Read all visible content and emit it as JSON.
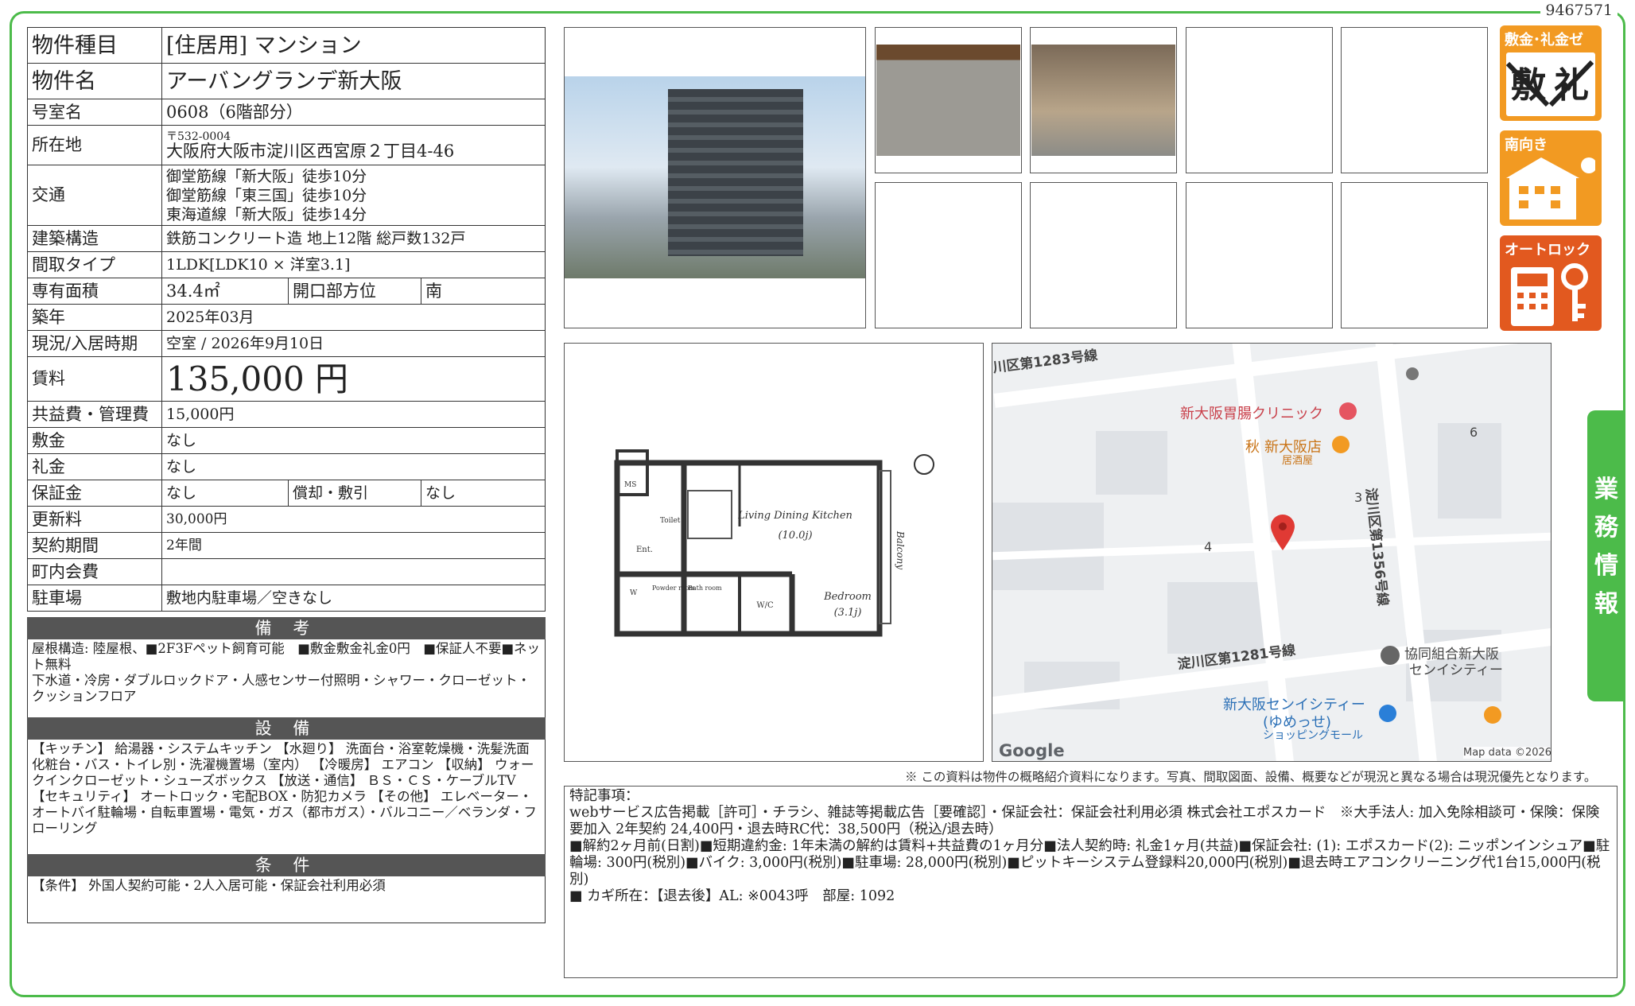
{
  "doc_id": "9467571",
  "rows": [
    {
      "label": "物件種目",
      "value": "[住居用]  マンション"
    },
    {
      "label": "物件名",
      "value": "アーバングランデ新大阪"
    },
    {
      "label": "号室名",
      "value": "0608（6階部分）"
    },
    {
      "label": "所在地",
      "postal": "〒532-0004",
      "value": "大阪府大阪市淀川区西宮原２丁目4-46"
    },
    {
      "label": "交通",
      "lines": [
        "御堂筋線「新大阪」徒歩10分",
        "御堂筋線「東三国」徒歩10分",
        "東海道線「新大阪」徒歩14分"
      ]
    },
    {
      "label": "建築構造",
      "value": "鉄筋コンクリート造 地上12階 総戸数132戸"
    },
    {
      "label": "間取タイプ",
      "value": "1LDK[LDK10 × 洋室3.1]"
    },
    {
      "label": "専有面積",
      "value": "34.4㎡",
      "label2": "開口部方位",
      "value2": "南"
    },
    {
      "label": "築年",
      "value": "2025年03月"
    },
    {
      "label": "現況/入居時期",
      "value": "空室 /  2026年9月10日"
    },
    {
      "label": "賃料",
      "value": "135,000 円"
    },
    {
      "label": "共益費・管理費",
      "value": "15,000円"
    },
    {
      "label": "敷金",
      "value": "なし"
    },
    {
      "label": "礼金",
      "value": "なし"
    },
    {
      "label": "保証金",
      "value": "なし",
      "label2": "償却・敷引",
      "value2": "なし"
    },
    {
      "label": "更新料",
      "value": "30,000円"
    },
    {
      "label": "契約期間",
      "value": "2年間"
    },
    {
      "label": "町内会費",
      "value": ""
    },
    {
      "label": "駐車場",
      "value": "敷地内駐車場／空きなし"
    }
  ],
  "remarks": {
    "title": "備 考",
    "text": "屋根構造: 陸屋根、■2F3Fペット飼育可能　■敷金敷金礼金0円　■保証人不要■ネット無料\n下水道・冷房・ダブルロックドア・人感センサー付照明・シャワー・クローゼット・クッションフロア"
  },
  "equipment": {
    "title": "設 備",
    "text": "【キッチン】 給湯器・システムキッチン 【水廻り】 洗面台・浴室乾燥機・洗髪洗面化粧台・バス・トイレ別・洗濯機置場（室内） 【冷暖房】 エアコン 【収納】 ウォークインクローゼット・シューズボックス 【放送・通信】 ＢＳ・ＣＳ・ケーブルTV 【セキュリティ】 オートロック・宅配BOX・防犯カメラ 【その他】 エレベーター・オートバイ駐輪場・自転車置場・電気・ガス（都市ガス）・バルコニー／ベランダ・フローリング"
  },
  "conditions": {
    "title": "条 件",
    "text": "【条件】 外国人契約可能・2人入居可能・保証会社利用必須"
  },
  "badges": [
    {
      "title": "敷金･礼金ゼロ",
      "icon": "no-deposit-icon"
    },
    {
      "title": "南向き",
      "icon": "south-facing-icon"
    },
    {
      "title": "オートロック",
      "icon": "autolock-icon"
    }
  ],
  "side_tab": "業務情報",
  "floor_plan": {
    "ldk": "Living Dining Kitchen",
    "ldk_size": "(10.0j)",
    "bedroom": "Bedroom",
    "bedroom_size": "(3.1j)",
    "balcony": "Balcony",
    "wic": "W/C",
    "ent": "Ent.",
    "toilet": "Toilet",
    "powder": "Powder room",
    "ms": "MS",
    "bath": "Bath room",
    "w": "W"
  },
  "map": {
    "road1": "川区第1283号線",
    "road2": "淀川区第1281号線",
    "road3": "淀川区第1356号線",
    "poi1": "新大阪胃腸クリニック",
    "poi2_a": "新大阪店",
    "poi2_b": "居酒屋",
    "poi2_prefix": "秋",
    "poi3_a": "協同組合新大阪",
    "poi3_b": "センイシティー",
    "poi4_a": "新大阪センイシティー",
    "poi4_b": "(ゆめっせ)",
    "poi4_c": "ショッピングモール",
    "n3": "3",
    "n4": "4",
    "n6": "6",
    "google": "Google",
    "mapdata": "Map data ©2026"
  },
  "disclaimer": "※ この資料は物件の概略紹介資料になります。写真、間取図面、設備、概要などが現況と異なる場合は現況優先となります。",
  "notes": {
    "title": "特記事項：",
    "lines": [
      "webサービス広告掲載［許可］・チラシ、雑誌等掲載広告［要確認］・保証会社：保証会社利用必須 株式会社エポスカード　※大手法人: 加入免除相談可・保険：保険要加入 2年契約 24,400円・退去時RC代：38,500円（税込/退去時）",
      "■解約2ヶ月前(日割)■短期違約金: 1年未満の解約は賃料+共益費の1ヶ月分■法人契約時: 礼金1ヶ月(共益)■保証会社: (1): エポスカード(2): ニッポンインシュア■駐輪場: 300円(税別)■バイク: 3,000円(税別)■駐車場: 28,000円(税別)■ピットキーシステム登録料20,000円(税別)■退去時エアコンクリーニング代1台15,000円(税別)",
      "■ カギ所在：【退去後】AL: ※0043呼　部屋: 1092"
    ]
  }
}
